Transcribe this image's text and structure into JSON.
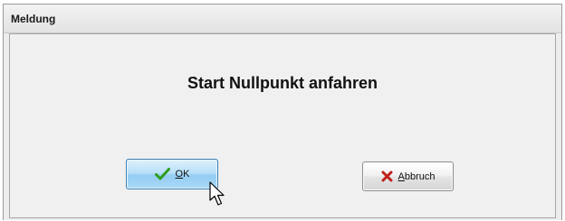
{
  "window": {
    "title": "Meldung"
  },
  "message": "Start Nullpunkt anfahren",
  "buttons": {
    "ok": {
      "accel": "O",
      "rest": "K",
      "icon": "checkmark-icon",
      "state": "hover"
    },
    "cancel": {
      "accel": "A",
      "rest": "bbruch",
      "icon": "red-x-icon"
    }
  },
  "colors": {
    "ok_highlight": "#a9d8f7",
    "checkmark": "#2e9d1e",
    "cancel_x": "#c0201a"
  }
}
